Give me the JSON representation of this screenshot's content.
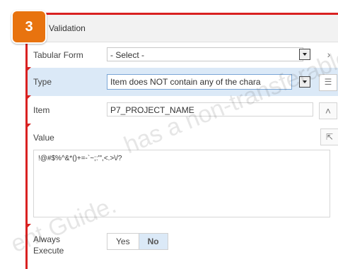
{
  "badge": "3",
  "header": {
    "title": "Validation"
  },
  "rows": {
    "tabular_form": {
      "label": "Tabular Form",
      "value": "- Select -"
    },
    "type": {
      "label": "Type",
      "value": "Item does NOT contain any of the chara"
    },
    "item": {
      "label": "Item",
      "value": "P7_PROJECT_NAME"
    },
    "value": {
      "label": "Value",
      "text": "!@#$%^&*()+=-`~;:'\",<.>\\/?"
    },
    "always_execute": {
      "label_line1": "Always",
      "label_line2": "Execute",
      "yes": "Yes",
      "no": "No",
      "selected": "No"
    }
  },
  "icons": {
    "tabular_dropdown": "chevron-down-icon",
    "tabular_next": "chevron-right-icon",
    "type_dropdown": "chevron-down-icon",
    "type_list": "list-icon",
    "item_collapse": "chevron-up-icon",
    "value_expand": "expand-icon"
  },
  "watermark": {
    "line1": "has a non-transferable",
    "line2": "ent Guide."
  },
  "colors": {
    "accent_red": "#d92121",
    "badge_orange": "#e8730f",
    "selected_blue": "#dbe9f7"
  }
}
